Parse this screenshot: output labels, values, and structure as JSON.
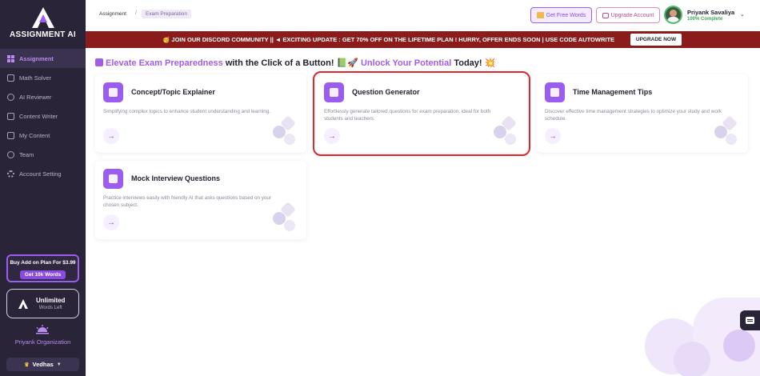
{
  "app": {
    "logo_text": "ASSIGNMENT AI"
  },
  "sidebar": {
    "items": [
      {
        "label": "Assignment",
        "icon": "grid-icon",
        "active": true
      },
      {
        "label": "Math Solver",
        "icon": "calculator-icon"
      },
      {
        "label": "AI Reviewer",
        "icon": "magnifier-icon"
      },
      {
        "label": "Content Writer",
        "icon": "pen-icon"
      },
      {
        "label": "My Content",
        "icon": "document-icon"
      },
      {
        "label": "Team",
        "icon": "team-icon"
      },
      {
        "label": "Account Setting",
        "icon": "gear-icon"
      }
    ],
    "addon": {
      "title": "Buy Add on Plan For $3.99",
      "button": "Get 10k Words"
    },
    "unlimited": {
      "title": "Unlimited",
      "subtitle": "Words Left"
    },
    "organization": "Priyank Organization",
    "workspace": "Vedhas"
  },
  "topbar": {
    "breadcrumb": [
      "Assignment",
      "Exam Preparation"
    ],
    "free_words": "Get Free Words",
    "upgrade_account": "Upgrade Account",
    "user": {
      "name": "Priyank Savaliya",
      "status": "100% Complete"
    }
  },
  "banner": {
    "text_part1": "🥳 JOIN OUR DISCORD COMMUNITY || ◄ EXCITING UPDATE : ",
    "text_part2": "GET 70% OFF",
    "text_part3": " ON THE LIFETIME PLAN ! HURRY, OFFER ENDS SOON | USE CODE ",
    "code": "AUTOWRITE",
    "button": "UPGRADE NOW"
  },
  "headline": {
    "part1": "Elevate Exam Preparedness",
    "part2": " with the Click of a Button! 📗🚀 ",
    "part3": "Unlock Your Potential",
    "part4": " Today! 💥"
  },
  "cards": [
    {
      "title": "Concept/Topic Explainer",
      "description": "Simplifying complex topics to enhance student understanding and learning."
    },
    {
      "title": "Question Generator",
      "description": "Effortlessly generate tailored questions for exam preparation, ideal for both students and teachers."
    },
    {
      "title": "Time Management Tips",
      "description": "Discover effective time management strategies to optimize your study and work schedule."
    },
    {
      "title": "Mock Interview Questions",
      "description": "Practice interviews easily with friendly AI that asks questions based on your chosen subject."
    }
  ],
  "colors": {
    "accent": "#9b5cf0",
    "sidebar_bg": "#2a2438",
    "banner_bg": "#8b1c1c",
    "selection": "#d9292f"
  }
}
